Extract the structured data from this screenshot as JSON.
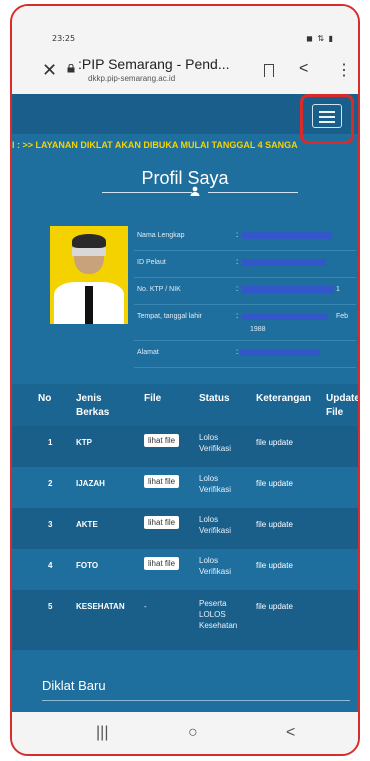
{
  "status_bar": {
    "time": "23:25",
    "right_icons": "◼ ⇅ ▮"
  },
  "browser": {
    "close_glyph": "✕",
    "title": ":PIP Semarang - Pend...",
    "host": "dkkp.pip-semarang.ac.id",
    "share_glyph": "<",
    "menu_glyph": "⋮"
  },
  "marquee": {
    "text": "I : >> LAYANAN DIKLAT AKAN DIBUKA MULAI TANGGAL 4 SANGA"
  },
  "profile": {
    "title": "Profil Saya",
    "fields": [
      {
        "label": "Nama Lengkap",
        "colon": ":"
      },
      {
        "label": "ID Pelaut",
        "colon": ":"
      },
      {
        "label": "No. KTP / NIK",
        "colon": ":",
        "tail": "1"
      },
      {
        "label": "Tempat, tanggal lahir",
        "colon": ":",
        "tail": "Feb",
        "line2": "1988"
      },
      {
        "label": "Alamat",
        "colon": ":"
      }
    ]
  },
  "table": {
    "headers": [
      "No",
      "Jenis Berkas",
      "File",
      "Status",
      "Keterangan",
      "Update File"
    ],
    "rows": [
      {
        "no": "1",
        "jenis": "KTP",
        "file": "lihat file",
        "status": "Lolos Verifikasi",
        "ket": "file update"
      },
      {
        "no": "2",
        "jenis": "IJAZAH",
        "file": "lihat file",
        "status": "Lolos Verifikasi",
        "ket": "file update"
      },
      {
        "no": "3",
        "jenis": "AKTE",
        "file": "lihat file",
        "status": "Lolos Verifikasi",
        "ket": "file update"
      },
      {
        "no": "4",
        "jenis": "FOTO",
        "file": "lihat file",
        "status": "Lolos Verifikasi",
        "ket": "file update"
      },
      {
        "no": "5",
        "jenis": "KESEHATAN",
        "file": "-",
        "status": "Peserta LOLOS Kesehatan",
        "ket": "file update"
      }
    ]
  },
  "diklat": {
    "title": "Diklat Baru"
  },
  "nav_bar": {
    "recents": "|||",
    "home": "○",
    "back": "<"
  },
  "colors": {
    "page_blue": "#1e6e9e",
    "marquee_yellow": "#f5d400",
    "highlight_red": "#d92b2b",
    "redacted_bar": "#3357c8"
  }
}
